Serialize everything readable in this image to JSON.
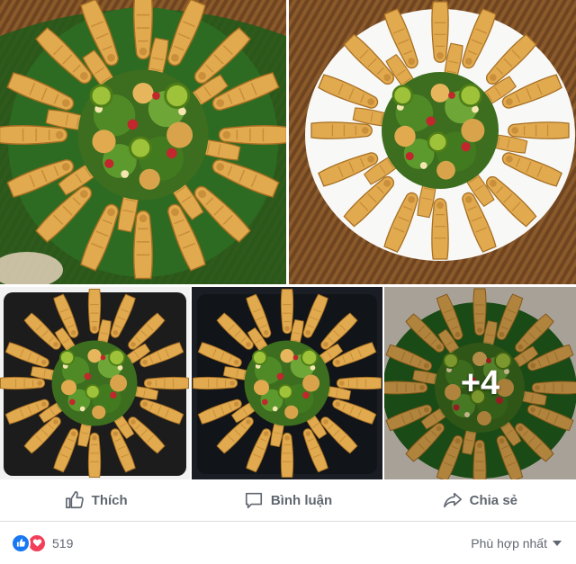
{
  "photos": [
    {
      "name": "photo-1",
      "subject": "chicken feet salad on banana leaf in rattan tray"
    },
    {
      "name": "photo-2",
      "subject": "chicken feet salad on white plate"
    },
    {
      "name": "photo-3",
      "subject": "chicken feet salad in black tray"
    },
    {
      "name": "photo-4",
      "subject": "chicken feet salad in black tray"
    },
    {
      "name": "photo-5",
      "subject": "chicken feet salad on banana leaf",
      "more_label": "+4"
    }
  ],
  "actions": {
    "like": {
      "label": "Thích",
      "icon": "thumbs-up-icon"
    },
    "comment": {
      "label": "Bình luận",
      "icon": "comment-icon"
    },
    "share": {
      "label": "Chia sẻ",
      "icon": "share-icon"
    }
  },
  "reactions": {
    "types": [
      "like",
      "love"
    ],
    "count": "519",
    "colors": {
      "like": "#1877f2",
      "love": "#f33e58"
    }
  },
  "sort": {
    "label": "Phù hợp nhất"
  },
  "colors": {
    "text_secondary": "#606770",
    "divider": "#dadde1"
  }
}
